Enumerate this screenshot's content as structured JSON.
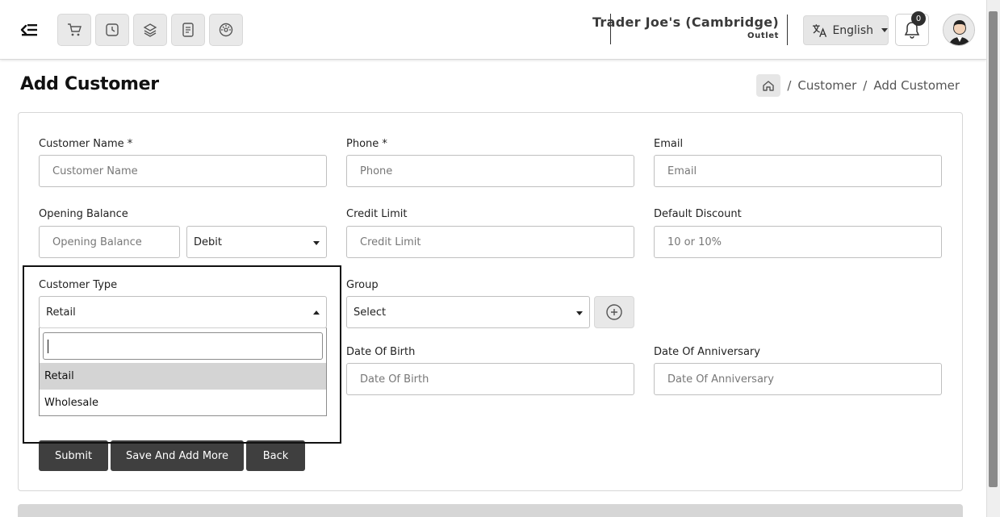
{
  "header": {
    "store_name": "Trader Joe's (Cambridge)",
    "store_sub": "Outlet",
    "language": "English",
    "notification_count": "0",
    "quick_icons": [
      "cart-icon",
      "history-icon",
      "layers-icon",
      "receipt-icon",
      "dashboard-icon"
    ]
  },
  "page": {
    "title": "Add Customer",
    "breadcrumb": [
      "Customer",
      "Add Customer"
    ]
  },
  "form": {
    "customer_name": {
      "label": "Customer Name *",
      "placeholder": "Customer Name"
    },
    "phone": {
      "label": "Phone *",
      "placeholder": "Phone"
    },
    "email": {
      "label": "Email",
      "placeholder": "Email"
    },
    "opening_balance": {
      "label": "Opening Balance",
      "placeholder": "Opening Balance",
      "type_value": "Debit"
    },
    "credit_limit": {
      "label": "Credit Limit",
      "placeholder": "Credit Limit"
    },
    "default_discount": {
      "label": "Default Discount",
      "placeholder": "10 or 10%"
    },
    "customer_type": {
      "label": "Customer Type",
      "value": "Retail",
      "options": [
        "Retail",
        "Wholesale"
      ]
    },
    "group": {
      "label": "Group",
      "value": "Select"
    },
    "date_of_birth": {
      "label": "Date Of Birth",
      "placeholder": "Date Of Birth"
    },
    "date_of_anniversary": {
      "label": "Date Of Anniversary",
      "placeholder": "Date Of Anniversary"
    }
  },
  "buttons": {
    "submit": "Submit",
    "save_add_more": "Save And Add More",
    "back": "Back"
  },
  "colors": {
    "button_bg": "#3f3f3f",
    "active_option": "#d4d4d4"
  }
}
